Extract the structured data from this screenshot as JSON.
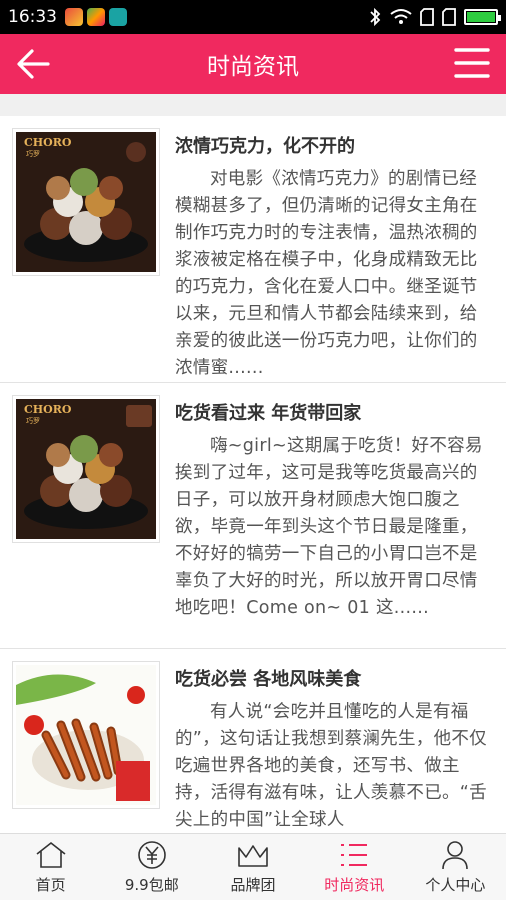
{
  "status": {
    "time": "16:33"
  },
  "header": {
    "title": "时尚资讯"
  },
  "articles": [
    {
      "title": "浓情巧克力，化不开的",
      "body": "对电影《浓情巧克力》的剧情已经模糊甚多了，但仍清晰的记得女主角在制作巧克力时的专注表情，温热浓稠的浆液被定格在模子中，化身成精致无比的巧克力，含化在爱人口中。继圣诞节以来，元旦和情人节都会陆续来到，给亲爱的彼此送一份巧克力吧，让你们的浓情蜜......",
      "image_brand": "CHORO",
      "image_sub": "巧罗"
    },
    {
      "title": "吃货看过来 年货带回家",
      "body": "嗨~girl~这期属于吃货！好不容易挨到了过年，这可是我等吃货最高兴的日子，可以放开身材顾虑大饱口腹之欲，毕竟一年到头这个节日最是隆重，不好好的犒劳一下自己的小胃口岂不是辜负了大好的时光，所以放开胃口尽情地吃吧！Come on~        01 这......",
      "image_brand": "CHORO",
      "image_sub": "巧罗"
    },
    {
      "title": "吃货必尝 各地风味美食",
      "body": "有人说“会吃并且懂吃的人是有福的”，这句话让我想到蔡澜先生，他不仅吃遍世界各地的美食，还写书、做主持，活得有滋有味，让人羡慕不已。“舌尖上的中国”让全球人"
    }
  ],
  "nav": [
    {
      "label": "首页",
      "icon": "home-icon"
    },
    {
      "label": "9.9包邮",
      "icon": "yen-icon"
    },
    {
      "label": "品牌团",
      "icon": "crown-icon"
    },
    {
      "label": "时尚资讯",
      "icon": "list-icon",
      "active": true
    },
    {
      "label": "个人中心",
      "icon": "person-icon"
    }
  ],
  "colors": {
    "accent": "#f0295f",
    "status_bar": "#000000"
  }
}
